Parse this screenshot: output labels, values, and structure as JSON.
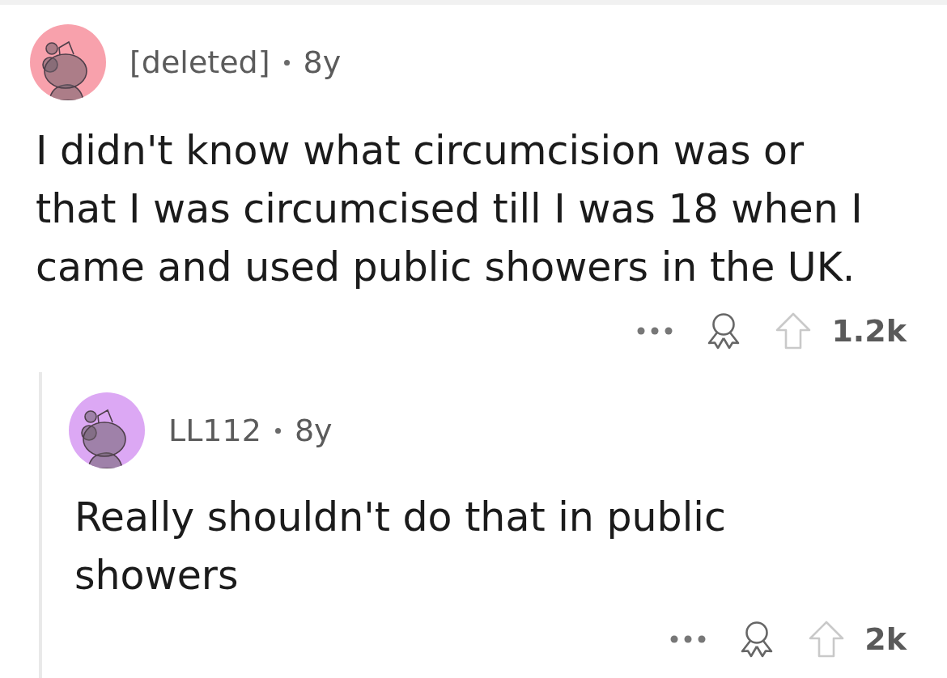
{
  "comments": [
    {
      "author": "[deleted]",
      "age": "8y",
      "color": "#f8a1ac",
      "body": "I didn't know what circumcision was or that I was circumcised till I was 18 when I came and used public showers in the UK.",
      "upvoted": false,
      "score": "1.2k",
      "replies": [
        {
          "author": "LL112",
          "age": "8y",
          "color": "#dca8f4",
          "body": "Really shouldn't do that in public showers",
          "upvoted": false,
          "score": "2k"
        }
      ]
    }
  ]
}
